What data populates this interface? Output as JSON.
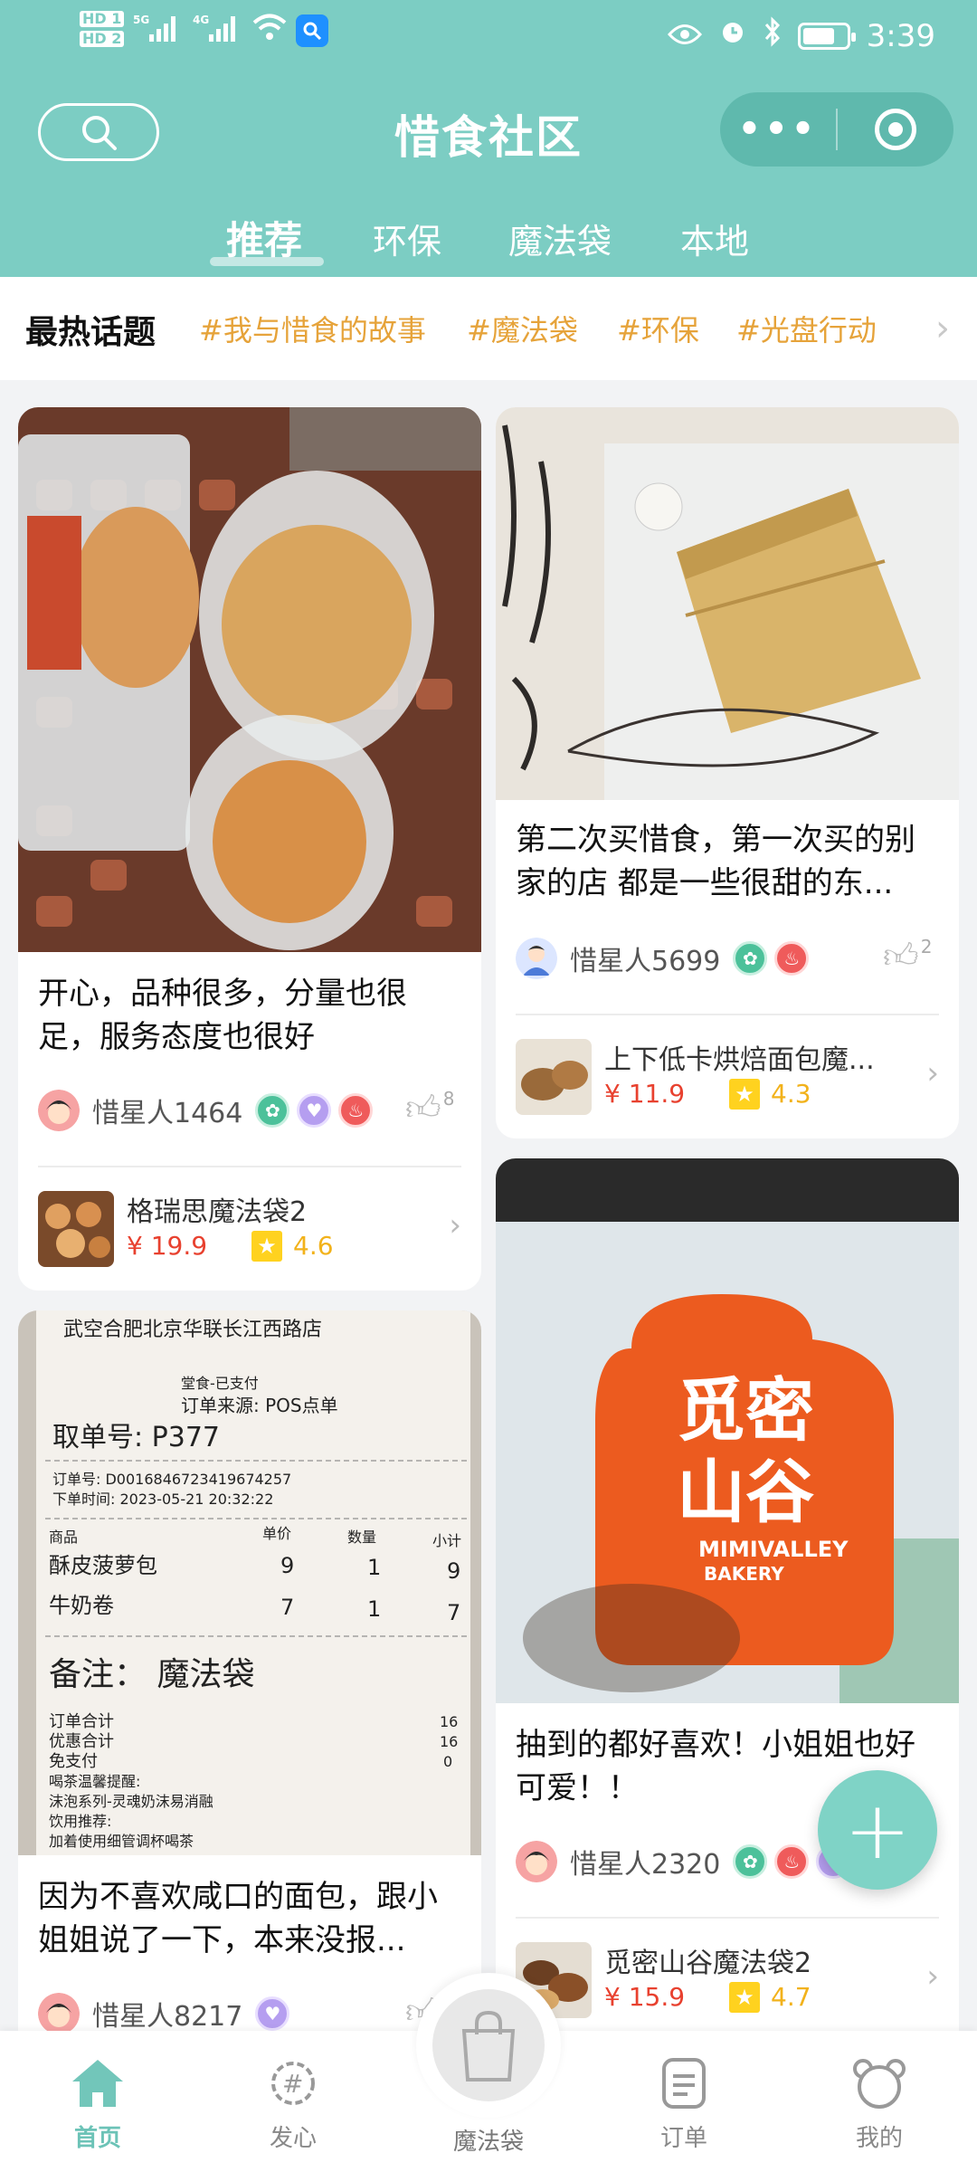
{
  "status_bar": {
    "hd1": "HD 1",
    "hd2": "HD 2",
    "sig1": "5G",
    "sig2": "4G",
    "time": "3:39",
    "icons": [
      "hd-icon",
      "signal-icon",
      "wifi-icon",
      "search-app-icon",
      "eye-icon",
      "alarm-icon",
      "bluetooth-icon",
      "battery-icon"
    ]
  },
  "header": {
    "title": "惜食社区",
    "more_label": "•••",
    "accent_color": "#7ccdc3"
  },
  "tabs": [
    {
      "label": "推荐",
      "active": true
    },
    {
      "label": "环保",
      "active": false
    },
    {
      "label": "魔法袋",
      "active": false
    },
    {
      "label": "本地",
      "active": false
    }
  ],
  "hot_topics": {
    "label": "最热话题",
    "topics": [
      "#我与惜食的故事",
      "#魔法袋",
      "#环保",
      "#光盘行动"
    ],
    "topic_color": "#e6a33a"
  },
  "posts": [
    {
      "caption": "开心，品种很多，分量也很足，服务态度也很好",
      "author": "惜星人1464",
      "likes": "8",
      "product": {
        "name": "格瑞思魔法袋2",
        "price": "¥ 19.9",
        "rating": "4.6"
      }
    },
    {
      "caption": "第二次买惜食，第一次买的别家的店 都是一些很甜的东...",
      "author": "惜星人5699",
      "likes": "2",
      "product": {
        "name": "上下低卡烘焙面包魔...",
        "price": "¥ 11.9",
        "rating": "4.3"
      }
    },
    {
      "caption": "因为不喜欢咸口的面包，跟小姐姐说了一下，本来没报...",
      "author": "惜星人8217",
      "likes": "",
      "receipt": {
        "store": "武空合肥北京华联长江西路店",
        "status": "堂食-已支付",
        "source": "订单来源: POS点单",
        "pickup": "取单号: P377",
        "order_no": "订单号: D0016846723419674257",
        "order_time": "下单时间: 2023-05-21 20:32:22",
        "col_item": "商品",
        "col_price": "单价",
        "col_qty": "数量",
        "col_sub": "小计",
        "row1": {
          "item": "酥皮菠萝包",
          "price": "9",
          "qty": "1",
          "sub": "9"
        },
        "row2": {
          "item": "牛奶卷",
          "price": "7",
          "qty": "1",
          "sub": "7"
        },
        "note": "备注： 魔法袋",
        "total_label": "订单合计",
        "total": "16",
        "discount_label": "优惠合计",
        "discount": "16",
        "pay_label": "免支付",
        "pay": "0",
        "tip1": "喝茶温馨提醒:",
        "tip2": "沫泡系列-灵魂奶沫易消融",
        "tip3": "饮用推荐:",
        "tip4": "加着使用细管调杯喝茶"
      }
    },
    {
      "caption": "抽到的都好喜欢！小姐姐也好可爱！！",
      "author": "惜星人2320",
      "likes": "",
      "bag_logo": {
        "line1": "觅密",
        "line2": "山谷",
        "brand": "MIMIVALLEY",
        "sub": "BAKERY"
      },
      "product": {
        "name": "觅密山谷魔法袋2",
        "price": "¥ 15.9",
        "rating": "4.7"
      }
    }
  ],
  "bottom_nav": [
    {
      "label": "首页",
      "active": true
    },
    {
      "label": "发心",
      "active": false
    },
    {
      "label": "魔法袋",
      "active": false
    },
    {
      "label": "订单",
      "active": false
    },
    {
      "label": "我的",
      "active": false
    }
  ],
  "fab_label": "+"
}
